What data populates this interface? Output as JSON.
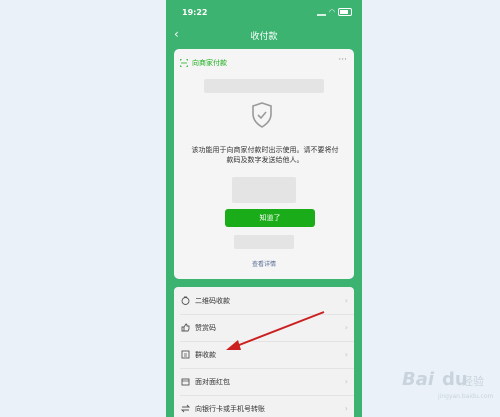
{
  "status_bar": {
    "time": "19:22"
  },
  "nav": {
    "title": "收付款"
  },
  "card": {
    "header_title": "向商家付款",
    "notice": "该功能用于向商家付款时出示使用。请不要将付款码及数字发送给他人。",
    "ok_button": "知道了",
    "details_link": "查看详情"
  },
  "list": {
    "items": [
      {
        "label": "二维码收款",
        "icon": "qr-money-icon"
      },
      {
        "label": "赞赏码",
        "icon": "like-icon"
      },
      {
        "label": "群收款",
        "icon": "group-collect-icon"
      },
      {
        "label": "面对面红包",
        "icon": "red-packet-icon"
      },
      {
        "label": "向银行卡或手机号转账",
        "icon": "transfer-icon"
      }
    ]
  },
  "watermark": {
    "brand": "Bai",
    "brand2": "du",
    "suffix": "经验",
    "url": "jingyan.baidu.com"
  },
  "colors": {
    "accent": "#3cb371",
    "button": "#1aad19",
    "link": "#576b95",
    "arrow": "#cc1f1f"
  }
}
